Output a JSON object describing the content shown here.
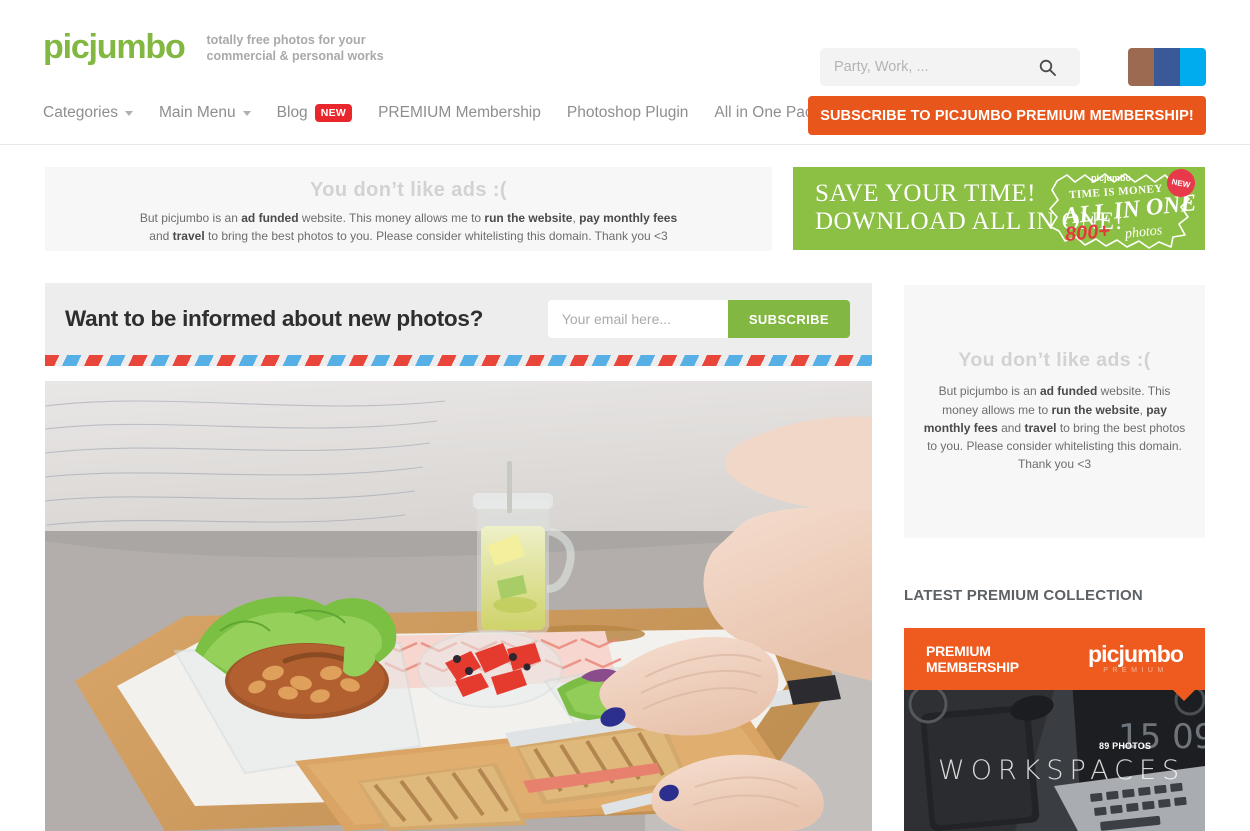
{
  "header": {
    "logo": "picjumbo",
    "tagline": "totally free photos for your commercial & personal works",
    "search": {
      "placeholder": "Party, Work, ...",
      "value": "",
      "icon": "search-icon"
    },
    "social": [
      {
        "name": "instagram",
        "color": "#9b6a50"
      },
      {
        "name": "facebook",
        "color": "#3b5998"
      },
      {
        "name": "twitter",
        "color": "#00aced"
      }
    ],
    "cta": {
      "label": "SUBSCRIBE TO PICJUMBO PREMIUM MEMBERSHIP!",
      "color": "#e8561b"
    }
  },
  "nav": {
    "items": [
      {
        "label": "Categories",
        "caret": true,
        "badge": ""
      },
      {
        "label": "Main Menu",
        "caret": true,
        "badge": ""
      },
      {
        "label": "Blog",
        "caret": false,
        "badge": "NEW"
      },
      {
        "label": "PREMIUM Membership",
        "caret": false,
        "badge": ""
      },
      {
        "label": "Photoshop Plugin",
        "caret": false,
        "badge": ""
      },
      {
        "label": "All in One Pack",
        "caret": false,
        "badge": ""
      }
    ]
  },
  "adblock_top": {
    "title": "You don’t like ads :(",
    "line1_a": "But picjumbo is an ",
    "line1_b": "ad funded",
    "line1_c": " website. This money allows me to ",
    "line1_d": "run the website",
    "line1_e": ", ",
    "line1_f": "pay monthly fees",
    "line2_a": "and ",
    "line2_b": "travel",
    "line2_c": " to bring the best photos to you. Please consider whitelisting this domain. Thank you <3"
  },
  "green_banner": {
    "line1": "SAVE YOUR TIME!",
    "line2": "DOWNLOAD ALL IN ONE!",
    "badge_brand": "picjumbo",
    "badge_tag": "TIME IS MONEY",
    "badge_main": "ALL IN ONE",
    "badge_count": "800+",
    "badge_photos": "photos",
    "badge_new": "NEW",
    "bg_color": "#8cc044"
  },
  "newsletter": {
    "title": "Want to be informed about new photos?",
    "email_placeholder": "Your email here...",
    "email_value": "",
    "button": "SUBSCRIBE",
    "button_color": "#82b741"
  },
  "photo": {
    "alt": "Breakfast tray in bed with salad, beans in lettuce, toast and lemonade, hands holding knife and fork"
  },
  "sidebar": {
    "adblock": {
      "title": "You don’t like ads :(",
      "p1_a": "But picjumbo is an ",
      "p1_b": "ad funded",
      "p1_c": " website. This money allows me to ",
      "p1_d": "run the website",
      "p1_e": ", ",
      "p1_f": "pay monthly fees",
      "p1_g": " and ",
      "p1_h": "travel",
      "p1_i": " to bring the best photos to you. Please consider whitelisting this domain. Thank you <3"
    },
    "collection_heading": "LATEST PREMIUM COLLECTION",
    "collection": {
      "banner_left_l1": "PREMIUM",
      "banner_left_l2": "MEMBERSHIP",
      "banner_logo": "picjumbo",
      "banner_logo_sub": "PREMIUM",
      "photo_count": "89 PHOTOS",
      "title": "WORKSPACES",
      "banner_color": "#ef5a1e"
    }
  }
}
